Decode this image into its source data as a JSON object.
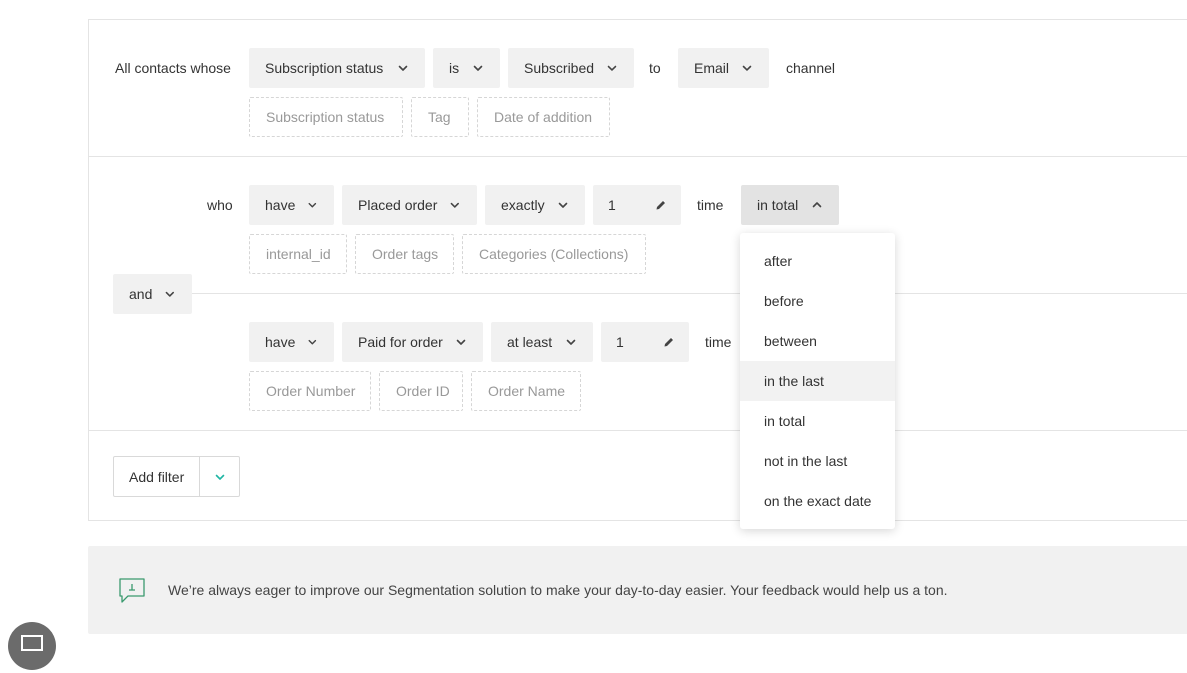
{
  "rule1": {
    "intro": "All contacts whose",
    "field": "Subscription status",
    "operator": "is",
    "value": "Subscribed",
    "to_label": "to",
    "channel_value": "Email",
    "channel_label": "channel",
    "chips": [
      "Subscription status",
      "Tag",
      "Date of addition"
    ]
  },
  "joiner": "and",
  "rule2": {
    "who_label": "who",
    "verb": "have",
    "event": "Placed order",
    "comparator": "exactly",
    "count": "1",
    "time_label": "time",
    "period": "in total",
    "chips": [
      "internal_id",
      "Order tags",
      "Categories (Collections)"
    ]
  },
  "rule3": {
    "verb": "have",
    "event": "Paid for order",
    "comparator": "at least",
    "count": "1",
    "time_label": "time",
    "chips": [
      "Order Number",
      "Order ID",
      "Order Name"
    ]
  },
  "add_filter": {
    "label": "Add filter"
  },
  "period_menu": {
    "options": [
      "after",
      "before",
      "between",
      "in the last",
      "in total",
      "not in the last",
      "on the exact date"
    ],
    "highlighted": "in the last"
  },
  "feedback": {
    "message": "We’re always eager to improve our Segmentation solution to make your day-to-day easier. Your feedback would help us a ton."
  },
  "colors": {
    "accent": "#1fb6a4",
    "select_bg": "#f1f1f1",
    "border": "#e4e4e4"
  }
}
